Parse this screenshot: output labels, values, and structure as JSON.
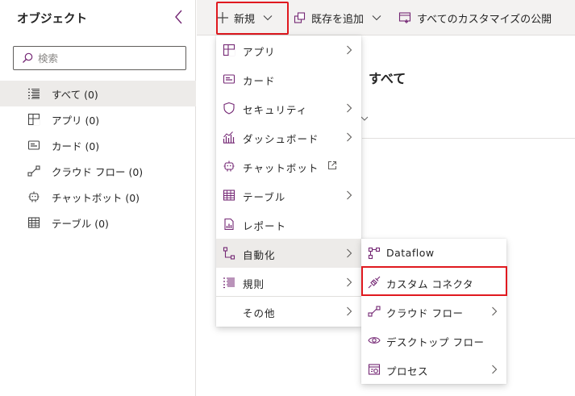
{
  "left_pane": {
    "title": "オブジェクト",
    "search_placeholder": "検索",
    "items": [
      {
        "label": "すべて (0)",
        "icon": "list-icon",
        "selected": true
      },
      {
        "label": "アプリ (0)",
        "icon": "app-icon"
      },
      {
        "label": "カード (0)",
        "icon": "card-icon"
      },
      {
        "label": "クラウド フロー (0)",
        "icon": "cloud-flow-icon"
      },
      {
        "label": "チャットボット (0)",
        "icon": "chatbot-icon"
      },
      {
        "label": "テーブル (0)",
        "icon": "table-icon"
      }
    ]
  },
  "toolbar": {
    "new_label": "新規",
    "add_existing_label": "既存を追加",
    "publish_label": "すべてのカスタマイズの公開"
  },
  "main": {
    "title": "すべて"
  },
  "new_menu": {
    "items": [
      {
        "label": "アプリ",
        "icon": "app-icon",
        "submenu": true
      },
      {
        "label": "カード",
        "icon": "card-icon"
      },
      {
        "label": "セキュリティ",
        "icon": "shield-icon",
        "submenu": true
      },
      {
        "label": "ダッシュボード",
        "icon": "dashboard-icon",
        "submenu": true
      },
      {
        "label": "チャットボット",
        "icon": "chatbot-icon",
        "external": true
      },
      {
        "label": "テーブル",
        "icon": "table-icon",
        "submenu": true
      },
      {
        "label": "レポート",
        "icon": "report-icon"
      },
      {
        "label": "自動化",
        "icon": "automation-icon",
        "submenu": true,
        "highlighted": true
      },
      {
        "label": "規則",
        "icon": "rules-icon",
        "submenu": true
      },
      {
        "label": "その他",
        "submenu": true
      }
    ]
  },
  "automation_submenu": {
    "items": [
      {
        "label": "Dataflow",
        "icon": "dataflow-icon"
      },
      {
        "label": "カスタム コネクタ",
        "icon": "custom-connector-icon",
        "outlined": true
      },
      {
        "label": "クラウド フロー",
        "icon": "cloud-flow-icon",
        "submenu": true
      },
      {
        "label": "デスクトップ フロー",
        "icon": "desktop-flow-icon"
      },
      {
        "label": "プロセス",
        "icon": "process-icon",
        "submenu": true
      }
    ]
  },
  "colors": {
    "accent": "#742774",
    "highlight_outline": "#e0191f",
    "selected_bg": "#edebe9",
    "toolbar_bg": "#f3f2f1"
  }
}
